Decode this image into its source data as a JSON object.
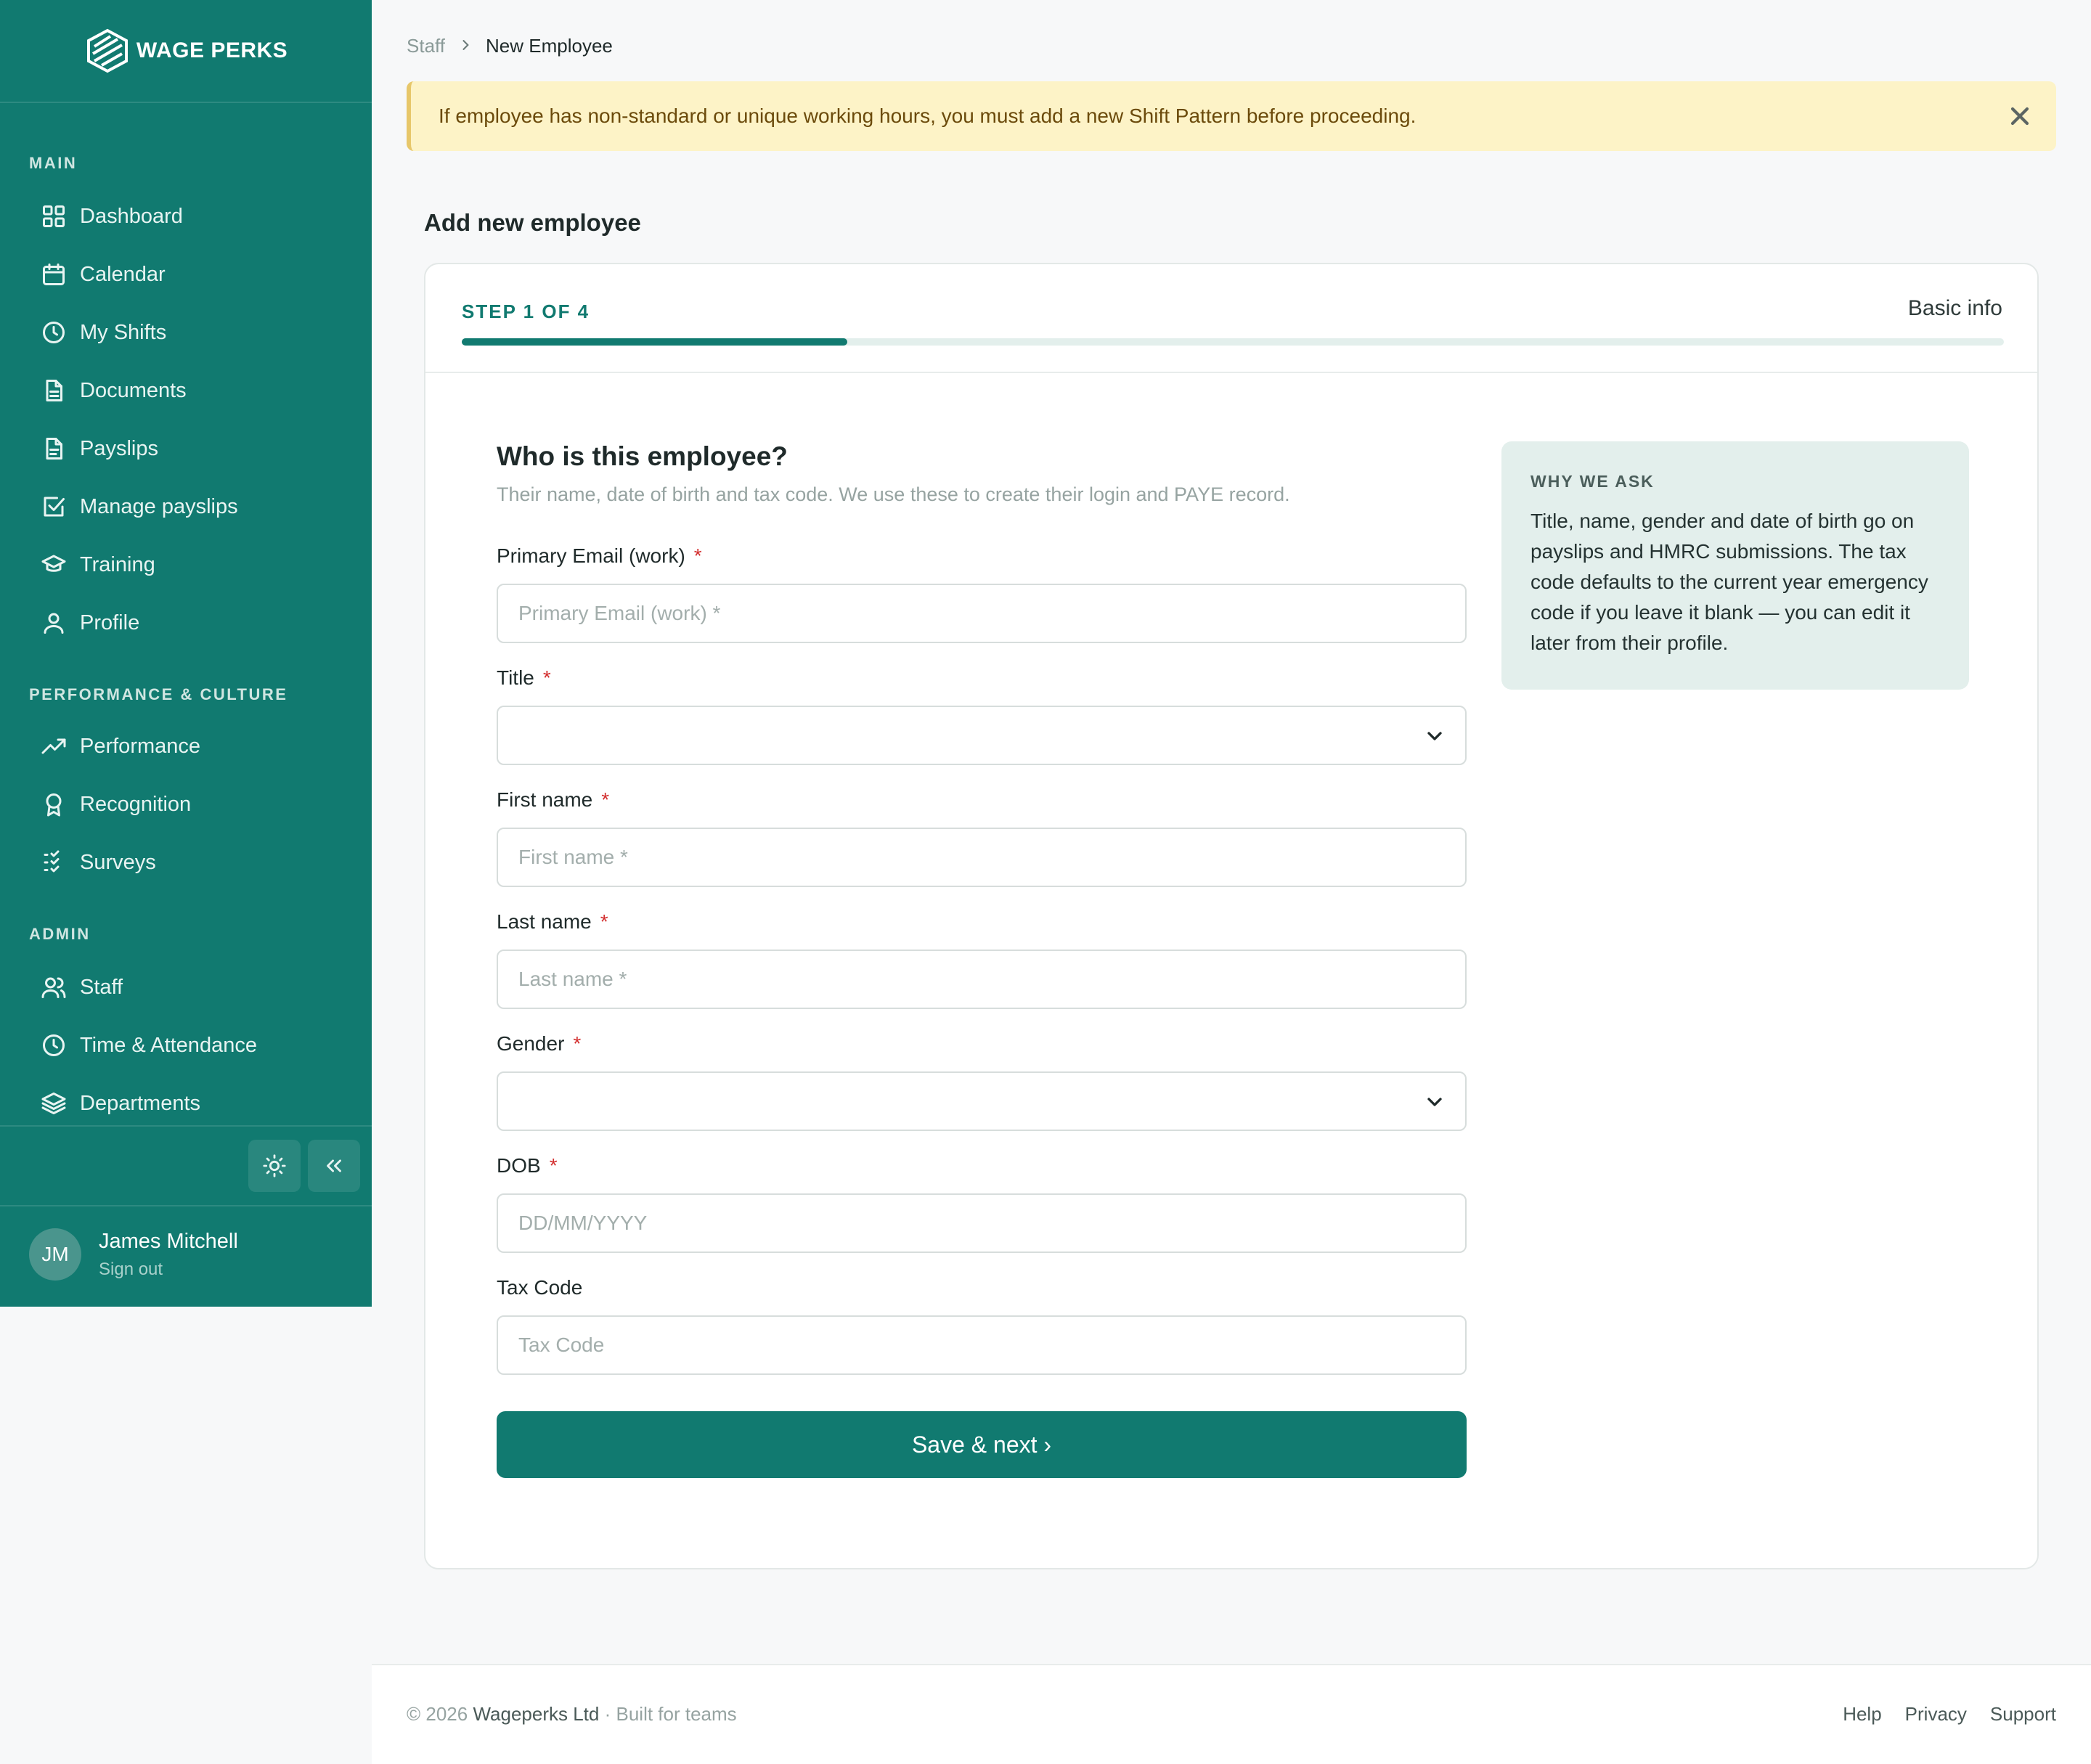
{
  "app": {
    "brand": "WAGE PERKS"
  },
  "sidebar": {
    "sections": [
      {
        "label": "MAIN"
      },
      {
        "label": "PERFORMANCE & CULTURE"
      },
      {
        "label": "ADMIN"
      }
    ],
    "items": [
      {
        "label": "Dashboard",
        "icon": "grid-icon"
      },
      {
        "label": "Calendar",
        "icon": "calendar-icon"
      },
      {
        "label": "My Shifts",
        "icon": "clock-icon"
      },
      {
        "label": "Documents",
        "icon": "document-icon"
      },
      {
        "label": "Payslips",
        "icon": "document-icon"
      },
      {
        "label": "Manage payslips",
        "icon": "checkbox-icon"
      },
      {
        "label": "Training",
        "icon": "graduation-cap-icon"
      },
      {
        "label": "Profile",
        "icon": "user-icon"
      },
      {
        "label": "Performance",
        "icon": "trending-up-icon"
      },
      {
        "label": "Recognition",
        "icon": "award-icon"
      },
      {
        "label": "Surveys",
        "icon": "checklist-icon"
      },
      {
        "label": "Staff",
        "icon": "users-icon"
      },
      {
        "label": "Time & Attendance",
        "icon": "clock-icon"
      },
      {
        "label": "Departments",
        "icon": "layers-icon"
      }
    ],
    "user": {
      "initials": "JM",
      "name": "James Mitchell",
      "signout": "Sign out"
    }
  },
  "breadcrumb": {
    "parent": "Staff",
    "current": "New Employee"
  },
  "alert": {
    "text": "If employee has non-standard or unique working hours, you must add a new Shift Pattern before proceeding."
  },
  "page": {
    "title": "Add new employee"
  },
  "wizard": {
    "step_label": "STEP 1 OF 4",
    "step_name": "Basic info",
    "progress": 0.25
  },
  "form": {
    "title": "Who is this employee?",
    "subtitle": "Their name, date of birth and tax code. We use these to create their login and PAYE record.",
    "fields": {
      "email": {
        "label": "Primary Email (work)",
        "placeholder": "Primary Email (work) *",
        "required": "*"
      },
      "title": {
        "label": "Title",
        "value": "",
        "required": "*"
      },
      "first_name": {
        "label": "First name",
        "placeholder": "First name *",
        "required": "*"
      },
      "last_name": {
        "label": "Last name",
        "placeholder": "Last name *",
        "required": "*"
      },
      "gender": {
        "label": "Gender",
        "value": "",
        "required": "*"
      },
      "dob": {
        "label": "DOB",
        "placeholder": "DD/MM/YYYY",
        "required": "*"
      },
      "tax_code": {
        "label": "Tax Code",
        "placeholder": "Tax Code"
      }
    },
    "submit": "Save & next ›"
  },
  "why": {
    "title": "WHY WE ASK",
    "text": "Title, name, gender and date of birth go on payslips and HMRC submissions. The tax code defaults to the current year emergency code if you leave it blank — you can edit it later from their profile."
  },
  "footer": {
    "copyright": "© 2026",
    "company": "Wageperks Ltd",
    "tagline": "· Built for teams",
    "links": [
      "Help",
      "Privacy",
      "Support"
    ]
  },
  "colors": {
    "brand": "#117a70",
    "alert_bg": "#fdf3c7",
    "required": "#d32f2f"
  }
}
